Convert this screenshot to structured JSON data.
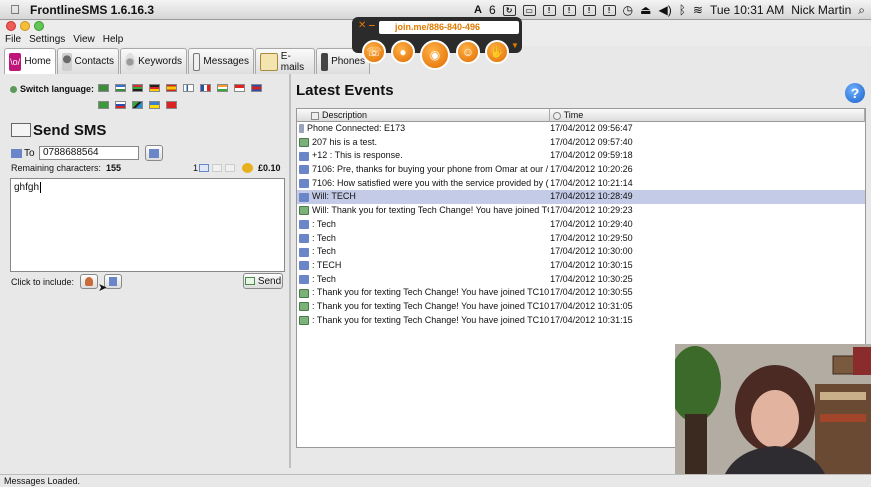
{
  "menubar": {
    "app_name": "FrontlineSMS 1.6.16.3",
    "status_number": "6",
    "clock": "Tue 10:31 AM",
    "user": "Nick Martin"
  },
  "app_menu": [
    "File",
    "Settings",
    "View",
    "Help"
  ],
  "joinme": {
    "url": "join.me/886-840-496"
  },
  "tabs": [
    {
      "label": "Home",
      "icon": "home-icon"
    },
    {
      "label": "Contacts",
      "icon": "contacts-icon"
    },
    {
      "label": "Keywords",
      "icon": "keywords-icon"
    },
    {
      "label": "Messages",
      "icon": "messages-icon"
    },
    {
      "label": "E-mails",
      "icon": "emails-icon"
    },
    {
      "label": "Phones",
      "icon": "phones-icon"
    }
  ],
  "language": {
    "label": "Switch language:"
  },
  "send_sms": {
    "title": "Send SMS",
    "to_label": "To",
    "to_value": "0788688564",
    "remaining_label": "Remaining characters:",
    "remaining_value": "155",
    "sms_count": "1",
    "cost": "£0.10",
    "message": "ghfgh",
    "include_label": "Click to include:",
    "send_label": "Send"
  },
  "events": {
    "title": "Latest Events",
    "col_description": "Description",
    "col_time": "Time",
    "rows": [
      {
        "desc": "Phone Connected: E173",
        "time": "17/04/2012 09:56:47",
        "icon": "phone-icon"
      },
      {
        "desc": "207                 his is a test.",
        "time": "17/04/2012 09:57:40",
        "icon": "sms-out-icon"
      },
      {
        "desc": "+12                : This is response.",
        "time": "17/04/2012 09:59:18",
        "icon": "sms-in-icon"
      },
      {
        "desc": "7106: Pre, thanks for buying your phone from Omar at our /",
        "time": "17/04/2012 10:20:26",
        "icon": "sms-in-icon"
      },
      {
        "desc": "7106: How satisfied were you with the service provided by (",
        "time": "17/04/2012 10:21:14",
        "icon": "sms-in-icon"
      },
      {
        "desc": "Will: TECH",
        "time": "17/04/2012 10:28:49",
        "icon": "sms-in-icon",
        "selected": true
      },
      {
        "desc": "Will: Thank you for texting Tech Change! You have joined TC",
        "time": "17/04/2012 10:29:23",
        "icon": "sms-out-icon"
      },
      {
        "desc": ": Tech",
        "time": "17/04/2012 10:29:40",
        "icon": "sms-in-icon"
      },
      {
        "desc": ": Tech",
        "time": "17/04/2012 10:29:50",
        "icon": "sms-in-icon"
      },
      {
        "desc": ": Tech",
        "time": "17/04/2012 10:30:00",
        "icon": "sms-in-icon"
      },
      {
        "desc": ": TECH",
        "time": "17/04/2012 10:30:15",
        "icon": "sms-in-icon"
      },
      {
        "desc": ": Tech",
        "time": "17/04/2012 10:30:25",
        "icon": "sms-in-icon"
      },
      {
        "desc": ": Thank you for texting Tech Change! You have joined TC10",
        "time": "17/04/2012 10:30:55",
        "icon": "sms-out-icon"
      },
      {
        "desc": ": Thank you for texting Tech Change! You have joined TC10",
        "time": "17/04/2012 10:31:05",
        "icon": "sms-out-icon"
      },
      {
        "desc": ": Thank you for texting Tech Change! You have joined TC10",
        "time": "17/04/2012 10:31:15",
        "icon": "sms-out-icon"
      }
    ]
  },
  "status": {
    "text": "Messages Loaded."
  },
  "colors": {
    "selected_row": "#c4cbe6",
    "accent_orange": "#e07a00",
    "help_blue": "#1a5fc8"
  }
}
